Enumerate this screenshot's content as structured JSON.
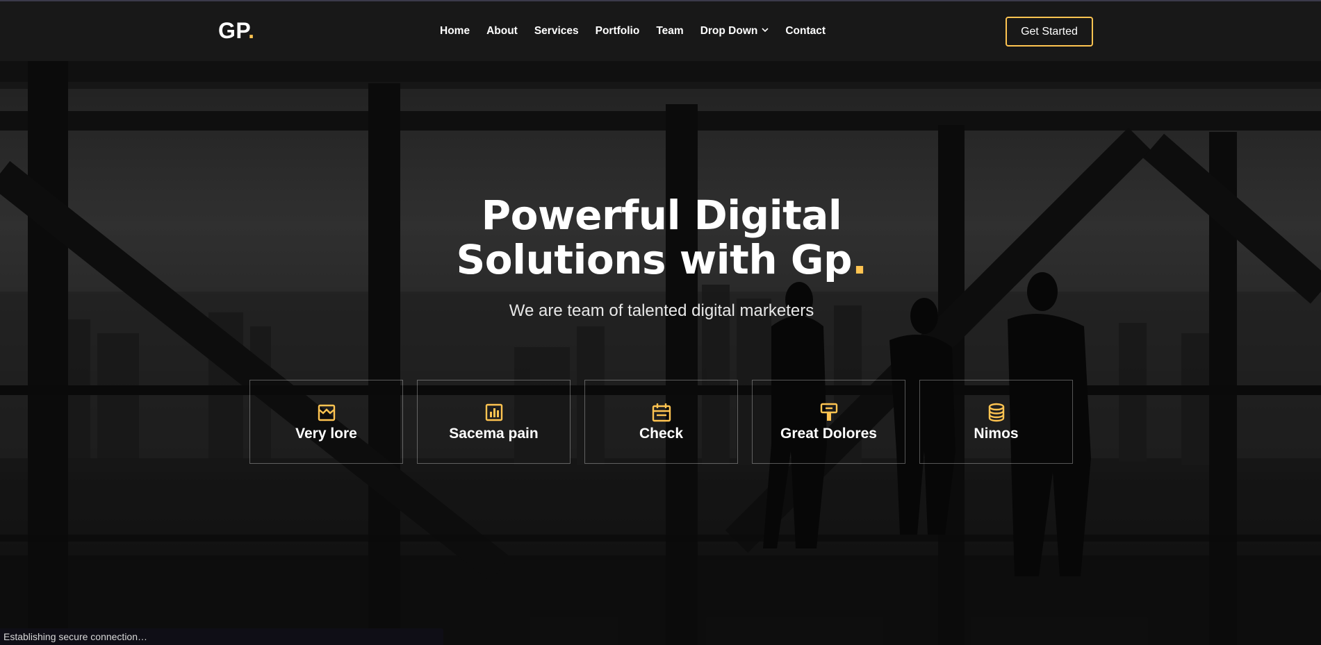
{
  "colors": {
    "accent": "#ffc451",
    "header_bg": "#181818",
    "text": "#ffffff"
  },
  "header": {
    "logo_text": "GP",
    "logo_dot": ".",
    "nav": [
      {
        "label": "Home"
      },
      {
        "label": "About"
      },
      {
        "label": "Services"
      },
      {
        "label": "Portfolio"
      },
      {
        "label": "Team"
      },
      {
        "label": "Drop Down",
        "icon": "chevron-down-icon"
      },
      {
        "label": "Contact"
      }
    ],
    "cta_label": "Get Started"
  },
  "hero": {
    "title_line1": "Powerful Digital",
    "title_line2": "Solutions with Gp",
    "title_dot": ".",
    "subtitle": "We are team of talented digital marketers",
    "features": [
      {
        "label": "Very lore",
        "icon": "store-icon"
      },
      {
        "label": "Sacema pain",
        "icon": "bar-chart-icon"
      },
      {
        "label": "Check",
        "icon": "calendar-todo-icon"
      },
      {
        "label": "Great Dolores",
        "icon": "paint-brush-icon"
      },
      {
        "label": "Nimos",
        "icon": "database-icon"
      }
    ]
  },
  "status": {
    "text": "Establishing secure connection…"
  }
}
